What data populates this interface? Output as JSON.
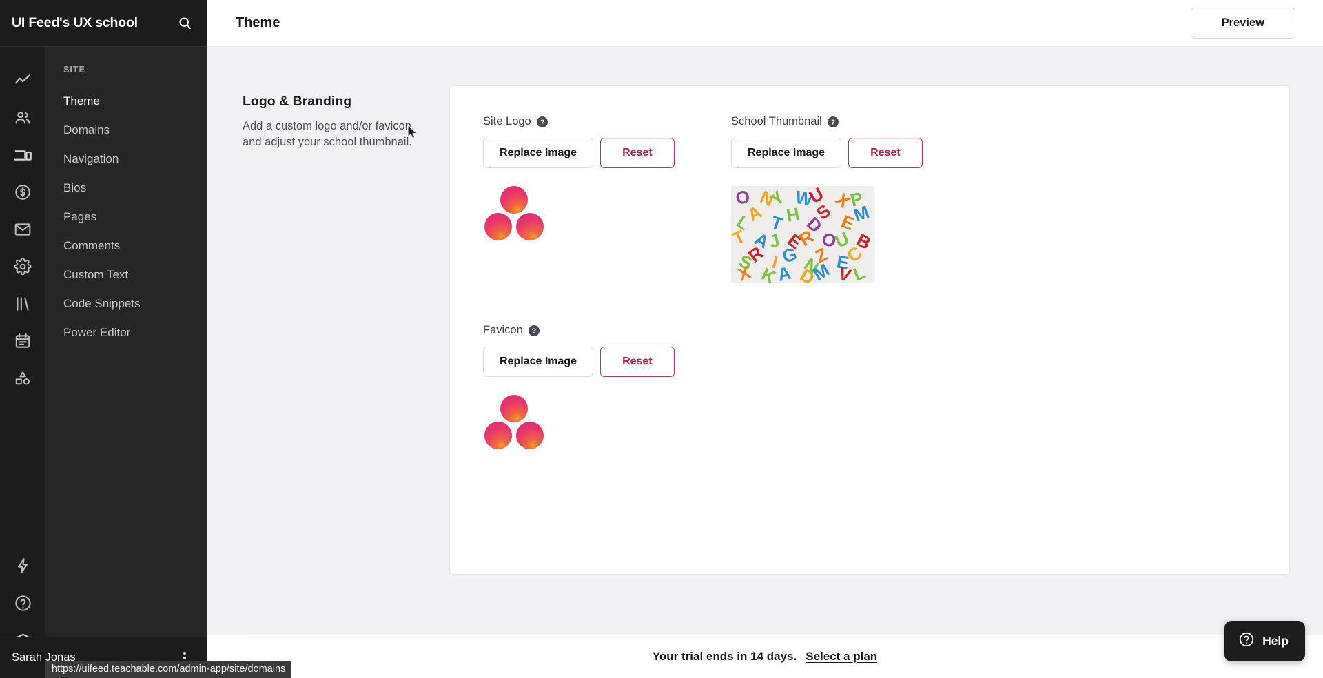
{
  "brand": {
    "title": "UI Feed's UX school",
    "search_icon": "search-icon"
  },
  "rail": {
    "icons_top": [
      {
        "name": "analytics-icon"
      },
      {
        "name": "users-icon"
      },
      {
        "name": "devices-icon"
      },
      {
        "name": "sales-dollar-icon"
      },
      {
        "name": "email-icon"
      },
      {
        "name": "settings-gear-icon"
      },
      {
        "name": "library-books-icon"
      },
      {
        "name": "calendar-icon"
      },
      {
        "name": "shapes-icon"
      }
    ],
    "icons_bottom": [
      {
        "name": "lightning-icon"
      },
      {
        "name": "help-circle-icon"
      },
      {
        "name": "graduation-cap-icon"
      }
    ]
  },
  "sidebar": {
    "section_label": "SITE",
    "items": [
      {
        "label": "Theme",
        "active": true
      },
      {
        "label": "Domains",
        "active": false
      },
      {
        "label": "Navigation",
        "active": false
      },
      {
        "label": "Bios",
        "active": false
      },
      {
        "label": "Pages",
        "active": false
      },
      {
        "label": "Comments",
        "active": false
      },
      {
        "label": "Custom Text",
        "active": false
      },
      {
        "label": "Code Snippets",
        "active": false
      },
      {
        "label": "Power Editor",
        "active": false
      }
    ],
    "user_name": "Sarah Jonas",
    "kebab_icon": "more-vertical-icon"
  },
  "status_bar": {
    "url": "https://uifeed.teachable.com/admin-app/site/domains"
  },
  "header": {
    "title": "Theme",
    "preview_label": "Preview"
  },
  "section": {
    "title": "Logo & Branding",
    "description": "Add a custom logo and/or favicon, and adjust your school thumbnail."
  },
  "fields": {
    "site_logo": {
      "label": "Site Logo",
      "help_icon": "help-circle-icon",
      "replace_label": "Replace Image",
      "reset_label": "Reset",
      "preview_type": "logo-three-circles"
    },
    "school_thumbnail": {
      "label": "School Thumbnail",
      "help_icon": "help-circle-icon",
      "replace_label": "Replace Image",
      "reset_label": "Reset",
      "preview_type": "alphabet-letters-photo"
    },
    "favicon": {
      "label": "Favicon",
      "help_icon": "help-circle-icon",
      "replace_label": "Replace Image",
      "reset_label": "Reset",
      "preview_type": "logo-three-circles"
    }
  },
  "trial": {
    "text": "Your trial ends in 14 days.",
    "link_label": "Select a plan"
  },
  "help_widget": {
    "label": "Help",
    "icon": "question-circle-icon"
  },
  "colors": {
    "rail_bg": "#1c1c1c",
    "subnav_bg": "#262626",
    "canvas_bg": "#f2f2f5",
    "danger": "#b32249",
    "danger_border": "#c3325a",
    "text_primary": "#17171f"
  }
}
